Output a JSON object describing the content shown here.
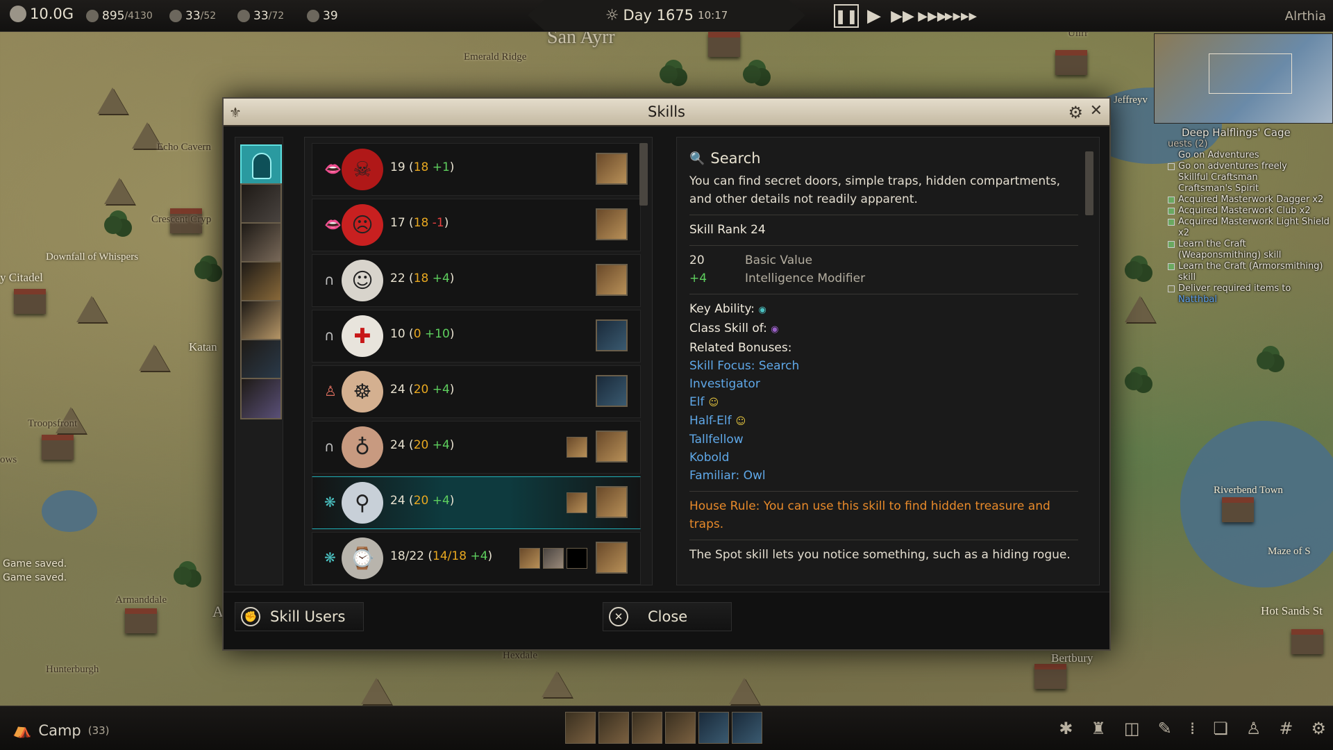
{
  "topbar": {
    "gold": "10.0G",
    "population": "895",
    "population_max": "/4130",
    "stat2": "33",
    "stat2_max": "/52",
    "stat3": "33",
    "stat3_max": "/72",
    "stat4": "39",
    "day": "Day 1675",
    "time": "10:17",
    "realm": "Alrthia",
    "speed_icons": [
      "pause-icon",
      "play-icon",
      "fast-forward-icon",
      "faster-icon",
      "fastest-icon"
    ]
  },
  "map": {
    "labels": {
      "san_ayrr": "San Ayrr",
      "emerald_ridge": "Emerald Ridge",
      "echo_cavern": "Echo Cavern",
      "crescent_crypt": "Crescent Cryp",
      "downfall": "Downfall of Whispers",
      "citadel": "y Citadel",
      "katan": "Katan",
      "troopsfront": "Troopsfront",
      "ows": "ows",
      "armandale": "Armanddale",
      "hunterburgh": "Hunterburgh",
      "hexdale": "Hexdale",
      "bertbury": "Bertbury",
      "riverbend": "Riverbend Town",
      "maze": "Maze of S",
      "hot_sands": "Hot Sands St",
      "jeffreyv": "Jeffreyv",
      "ulirr": "Ulirr",
      "a_edge": "A"
    },
    "system_messages": [
      "Game saved.",
      "Game saved."
    ]
  },
  "quests": {
    "title": "Deep Halflings' Cage",
    "count": "uests (2)",
    "lines": [
      {
        "text": "Go on Adventures",
        "checkbox": false
      },
      {
        "text": "Go on adventures freely",
        "checkbox": true,
        "checked": false
      },
      {
        "text": "Skillful Craftsman",
        "checkbox": false
      },
      {
        "text": "Craftsman's Spirit",
        "checkbox": false
      },
      {
        "text": "Acquired Masterwork Dagger x2",
        "checkbox": true,
        "checked": true
      },
      {
        "text": "Acquired Masterwork Club x2",
        "checkbox": true,
        "checked": true
      },
      {
        "text": "Acquired Masterwork Light Shield",
        "checkbox": true,
        "checked": true
      },
      {
        "text": "x2",
        "checkbox": false
      },
      {
        "text": "Learn the Craft",
        "checkbox": true,
        "checked": true
      },
      {
        "text": "(Weaponsmithing) skill",
        "checkbox": false
      },
      {
        "text": "Learn the Craft (Armorsmithing)",
        "checkbox": true,
        "checked": true
      },
      {
        "text": "skill",
        "checkbox": false
      },
      {
        "text": "Deliver required items to",
        "checkbox": true,
        "checked": false
      },
      {
        "text": "Natthbal",
        "checkbox": false,
        "highlight": true
      }
    ]
  },
  "dialog": {
    "title": "Skills",
    "portraits": [
      "selected-group",
      "warrior",
      "dwarf",
      "mage",
      "elf",
      "rogue",
      "sorceress"
    ],
    "skills": [
      {
        "stat_icon": "lips-icon",
        "skill_icon": "demon-mask-icon",
        "total": "19",
        "base": "18",
        "mod": "+1",
        "mod_sign": "pos",
        "icon_bg": "#b01818",
        "extra_sources": [],
        "source": "mage"
      },
      {
        "stat_icon": "lips-icon",
        "skill_icon": "red-mask-icon",
        "total": "17",
        "base": "18",
        "mod": "-1",
        "mod_sign": "neg",
        "icon_bg": "#c82020",
        "extra_sources": [],
        "source": "mage"
      },
      {
        "stat_icon": "horseshoe-icon",
        "skill_icon": "face-icon",
        "total": "22",
        "base": "18",
        "mod": "+4",
        "mod_sign": "pos",
        "icon_bg": "#d8d4cc",
        "extra_sources": [],
        "source": "mage"
      },
      {
        "stat_icon": "horseshoe-icon",
        "skill_icon": "red-cross-icon",
        "total": "10",
        "base": "0",
        "mod": "+10",
        "mod_sign": "pos",
        "icon_bg": "#e8e4dc",
        "extra_sources": [],
        "source": "rogue"
      },
      {
        "stat_icon": "figure-icon",
        "skill_icon": "meditation-icon",
        "total": "24",
        "base": "20",
        "mod": "+4",
        "mod_sign": "pos",
        "icon_bg": "#d4b090",
        "extra_sources": [],
        "source": "rogue"
      },
      {
        "stat_icon": "horseshoe-icon",
        "skill_icon": "listen-icon",
        "total": "24",
        "base": "20",
        "mod": "+4",
        "mod_sign": "pos",
        "icon_bg": "#c89a80",
        "extra_sources": [
          "mage"
        ],
        "source": "mage"
      },
      {
        "stat_icon": "brain-icon",
        "skill_icon": "magnifier-icon",
        "total": "24",
        "base": "20",
        "mod": "+4",
        "mod_sign": "pos",
        "icon_bg": "#c8d0d8",
        "extra_sources": [
          "mage"
        ],
        "source": "mage",
        "selected": true
      },
      {
        "stat_icon": "brain-icon",
        "skill_icon": "trap-icon",
        "total": "18/22",
        "base": "14/18",
        "mod": "+4",
        "mod_sign": "pos",
        "icon_bg": "#b8b4ac",
        "extra_sources": [
          "mage",
          "dwarf",
          "empty"
        ],
        "source": "mage"
      }
    ],
    "detail": {
      "title": "Search",
      "description": "You can find secret doors, simple traps, hidden compartments, and other details not readily apparent.",
      "rank_label": "Skill Rank",
      "rank_value": "24",
      "breakdown": [
        {
          "value": "20",
          "label": "Basic Value",
          "positive": false
        },
        {
          "value": "+4",
          "label": "Intelligence Modifier",
          "positive": true
        }
      ],
      "key_ability_label": "Key Ability:",
      "class_skill_label": "Class Skill of:",
      "related_label": "Related Bonuses:",
      "related": [
        "Skill Focus: Search",
        "Investigator",
        "Elf",
        "Half-Elf",
        "Tallfellow",
        "Kobold",
        "Familiar: Owl"
      ],
      "related_face_icons": [
        false,
        false,
        true,
        true,
        false,
        false,
        false
      ],
      "house_rule": "House Rule: You can use this skill to find hidden treasure and traps.",
      "note": "The Spot skill lets you notice something, such as a hiding rogue."
    },
    "footer": {
      "skill_users": "Skill Users",
      "close": "Close"
    }
  },
  "bottombar": {
    "camp": "Camp",
    "camp_count": "(33)",
    "tray_icons": [
      "bug-icon",
      "castle-icon",
      "barrel-icon",
      "torch-icon",
      "grid-dots-icon",
      "book-icon",
      "character-add-icon",
      "hash-icon",
      "gear-icon"
    ]
  }
}
